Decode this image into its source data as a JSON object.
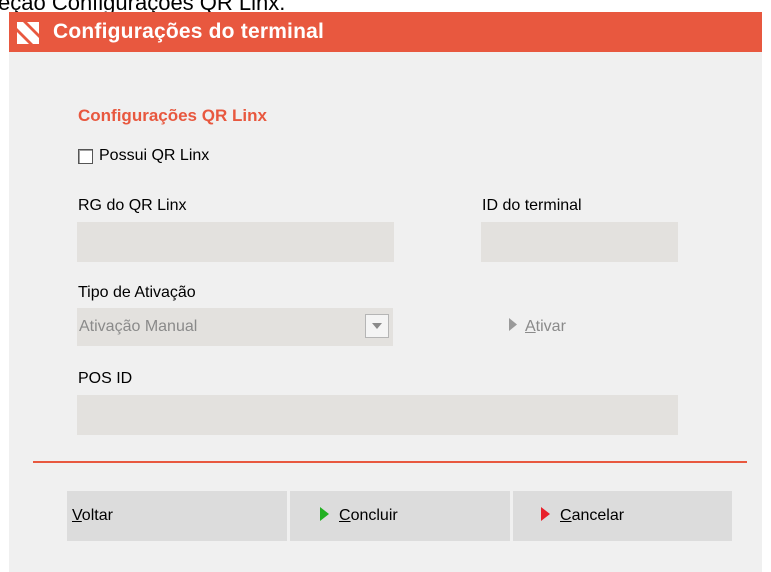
{
  "caption": "eção Configurações QR Linx.",
  "window": {
    "title": "Configurações do terminal",
    "brand_color": "#e8583f"
  },
  "section": {
    "title": "Configurações QR Linx",
    "checkbox_label": "Possui QR Linx",
    "checkbox_checked": false
  },
  "fields": {
    "rg_label": "RG do QR Linx",
    "rg_value": "",
    "terminal_id_label": "ID do terminal",
    "terminal_id_value": "",
    "activation_type_label": "Tipo de Ativação",
    "activation_type_value": "Ativação Manual",
    "activate_label": "Ativar",
    "pos_id_label": "POS ID",
    "pos_id_value": ""
  },
  "buttons": {
    "back": "Voltar",
    "finish": "Concluir",
    "cancel": "Cancelar"
  },
  "icons": {
    "logo": "brand-logo-icon",
    "dropdown": "chevron-down-icon",
    "activate": "play-arrow-icon",
    "finish": "green-play-icon",
    "cancel": "red-play-icon"
  },
  "colors": {
    "finish_arrow": "#22b022",
    "cancel_arrow": "#e8202a",
    "disabled_text": "#8a8a8a"
  }
}
